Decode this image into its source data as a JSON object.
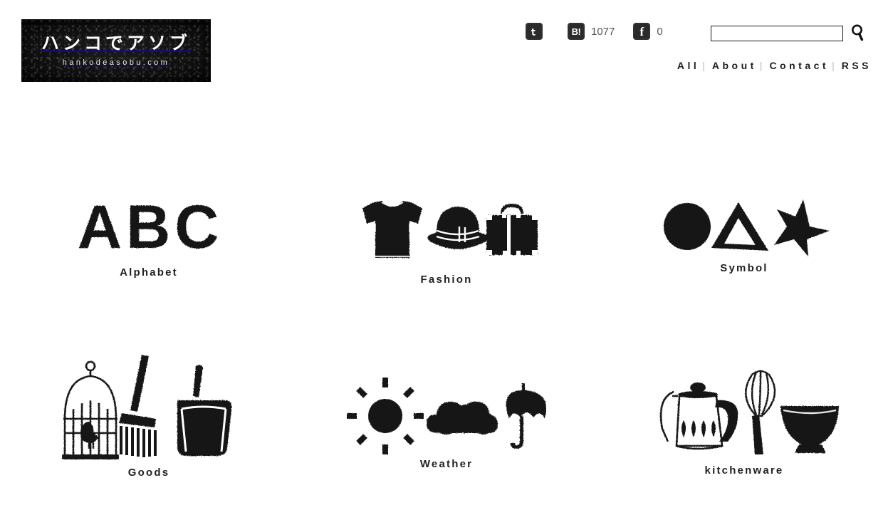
{
  "site": {
    "logo_main": "ハンコでアソブ",
    "logo_sub": "hankodeasobu.com",
    "logo_icon": "stamp-logo"
  },
  "header": {
    "social": [
      {
        "name": "twitter",
        "icon": "twitter-icon",
        "glyph": "t",
        "count": ""
      },
      {
        "name": "hatena",
        "icon": "hatena-bookmark-icon",
        "glyph": "B!",
        "count": "1077"
      },
      {
        "name": "facebook",
        "icon": "facebook-icon",
        "glyph": "f",
        "count": "0"
      }
    ],
    "search": {
      "value": "",
      "placeholder": "",
      "icon": "search-icon"
    },
    "nav": {
      "separator": "|",
      "items": [
        {
          "label": "All"
        },
        {
          "label": "About"
        },
        {
          "label": "Contact"
        },
        {
          "label": "RSS"
        }
      ]
    }
  },
  "categories": [
    {
      "label": "Alphabet",
      "art": "abc-stamp-art"
    },
    {
      "label": "Fashion",
      "art": "fashion-stamp-art"
    },
    {
      "label": "Symbol",
      "art": "symbol-stamp-art"
    },
    {
      "label": "Goods",
      "art": "goods-stamp-art"
    },
    {
      "label": "Weather",
      "art": "weather-stamp-art"
    },
    {
      "label": "kitchenware",
      "art": "kitchenware-stamp-art"
    }
  ],
  "colors": {
    "ink": "#1a1a1a",
    "text": "#222222",
    "muted": "#555555",
    "background": "#ffffff"
  }
}
